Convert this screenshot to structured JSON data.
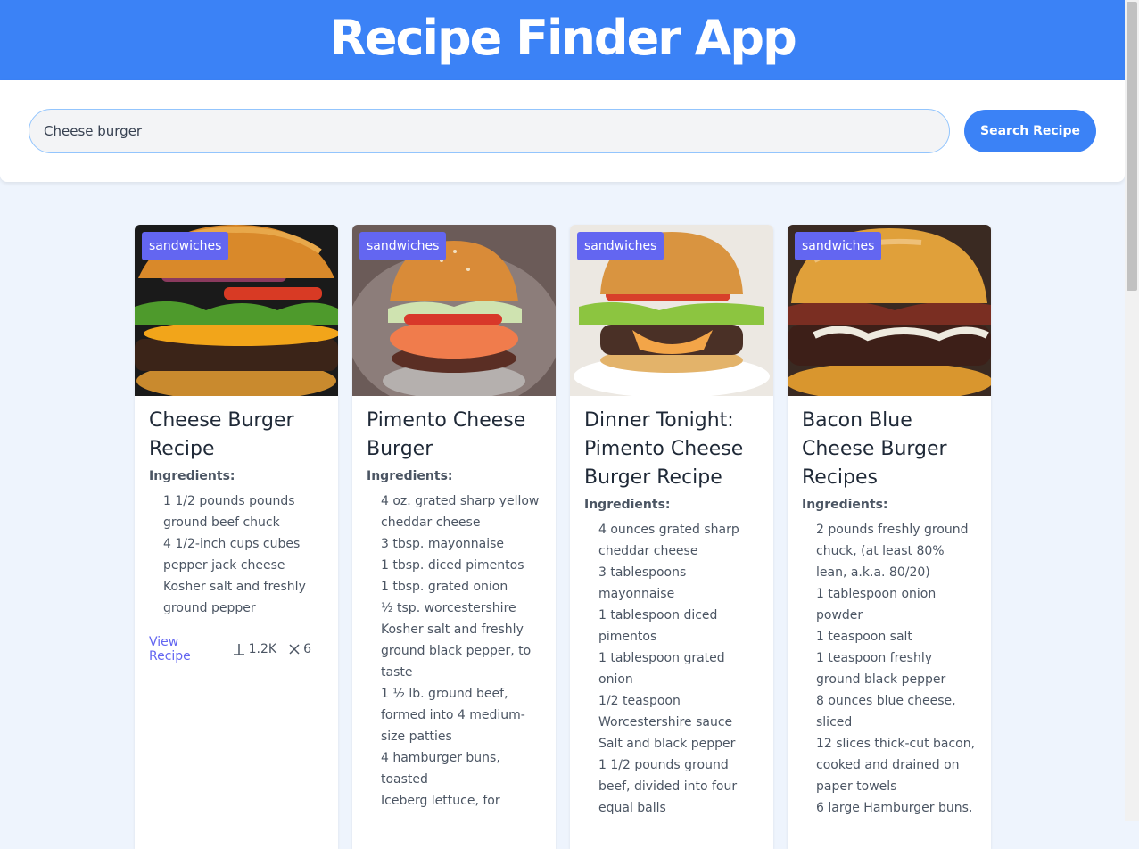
{
  "app": {
    "title": "Recipe Finder App"
  },
  "search": {
    "value": "Cheese burger",
    "button_label": "Search Recipe"
  },
  "recipes": [
    {
      "category": "sandwiches",
      "title": "Cheese Burger Recipe",
      "ingredients_label": "Ingredients:",
      "ingredients": [
        "1 1/2 pounds pounds ground beef chuck",
        "4 1/2-inch cups cubes pepper jack cheese",
        "Kosher salt and freshly ground pepper"
      ],
      "view_label": "View Recipe",
      "stat_a": "1.2K",
      "stat_b": "6",
      "stat_a_icon": "pin-icon",
      "stat_b_icon": "close-icon"
    },
    {
      "category": "sandwiches",
      "title": "Pimento Cheese Burger",
      "ingredients_label": "Ingredients:",
      "ingredients": [
        "4 oz. grated sharp yellow cheddar cheese",
        "3 tbsp. mayonnaise",
        "1 tbsp. diced pimentos",
        "1 tbsp. grated onion",
        "½ tsp. worcestershire",
        "Kosher salt and freshly ground black pepper, to taste",
        "1 ½ lb. ground beef, formed into 4 medium-size patties",
        "4 hamburger buns, toasted",
        "Iceberg lettuce, for"
      ]
    },
    {
      "category": "sandwiches",
      "title": "Dinner Tonight: Pimento Cheese Burger Recipe",
      "ingredients_label": "Ingredients:",
      "ingredients": [
        "4 ounces grated sharp cheddar cheese",
        "3 tablespoons mayonnaise",
        "1 tablespoon diced pimentos",
        "1 tablespoon grated onion",
        "1/2 teaspoon Worcestershire sauce",
        "Salt and black pepper",
        "1 1/2 pounds ground beef, divided into four equal balls"
      ]
    },
    {
      "category": "sandwiches",
      "title": "Bacon Blue Cheese Burger Recipes",
      "ingredients_label": "Ingredients:",
      "ingredients": [
        "2 pounds freshly ground chuck, (at least 80% lean, a.k.a. 80/20)",
        "1 tablespoon onion powder",
        "1 teaspoon salt",
        "1 teaspoon freshly ground black pepper",
        "8 ounces blue cheese, sliced",
        "12 slices thick-cut bacon, cooked and drained on paper towels",
        "6 large Hamburger buns,"
      ]
    }
  ]
}
